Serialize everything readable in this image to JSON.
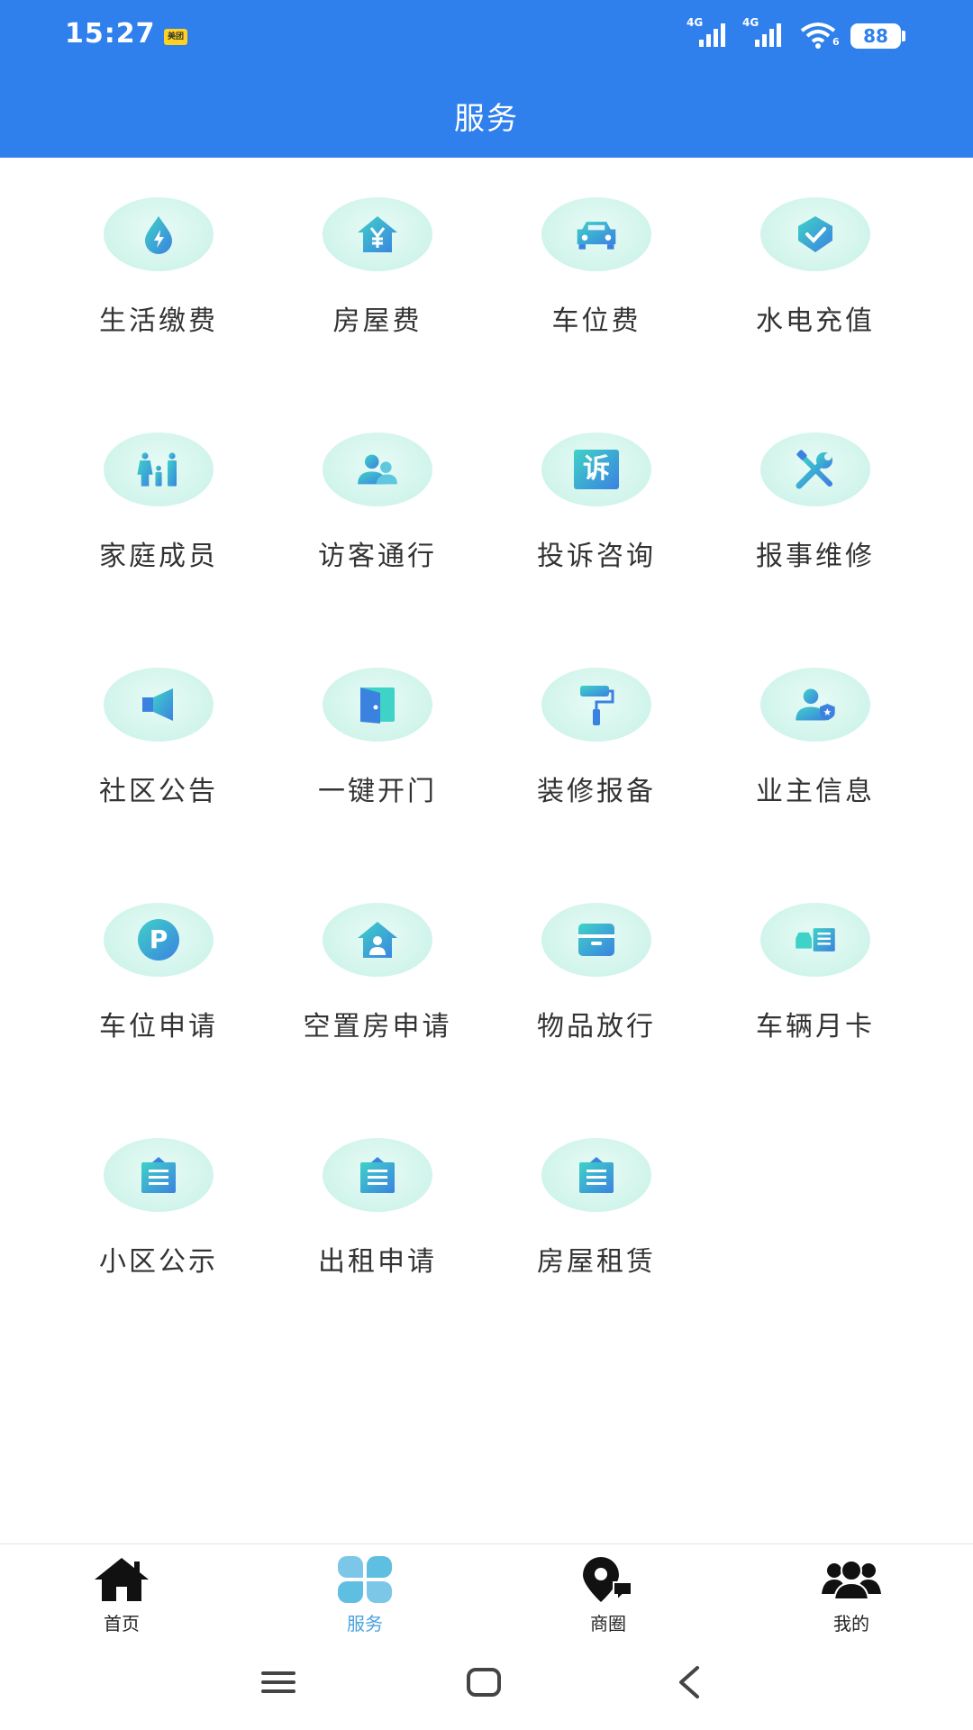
{
  "status_bar": {
    "time": "15:27",
    "notification_label": "美团",
    "signal_1": "4G",
    "signal_2": "4G",
    "wifi_sub": "6",
    "battery": "88"
  },
  "header": {
    "title": "服务"
  },
  "colors": {
    "primary": "#2f80ed",
    "bubble": "#c6f1e6",
    "icon_start": "#3fd2c7",
    "icon_end": "#3b82e0",
    "tab_active": "#4aa3df"
  },
  "services": [
    {
      "label": "生活缴费",
      "icon": "drop-bolt-icon"
    },
    {
      "label": "房屋费",
      "icon": "house-yuan-icon"
    },
    {
      "label": "车位费",
      "icon": "car-icon"
    },
    {
      "label": "水电充值",
      "icon": "check-shield-icon"
    },
    {
      "label": "家庭成员",
      "icon": "family-icon"
    },
    {
      "label": "访客通行",
      "icon": "visitors-icon"
    },
    {
      "label": "投诉咨询",
      "icon": "complaint-icon",
      "glyph": "诉"
    },
    {
      "label": "报事维修",
      "icon": "wrench-screwdriver-icon"
    },
    {
      "label": "社区公告",
      "icon": "megaphone-icon"
    },
    {
      "label": "一键开门",
      "icon": "door-icon"
    },
    {
      "label": "装修报备",
      "icon": "paint-roller-icon"
    },
    {
      "label": "业主信息",
      "icon": "owner-badge-icon"
    },
    {
      "label": "车位申请",
      "icon": "parking-icon",
      "glyph": "P"
    },
    {
      "label": "空置房申请",
      "icon": "house-person-icon"
    },
    {
      "label": "物品放行",
      "icon": "box-icon"
    },
    {
      "label": "车辆月卡",
      "icon": "car-card-icon"
    },
    {
      "label": "小区公示",
      "icon": "notice-board-icon"
    },
    {
      "label": "出租申请",
      "icon": "notice-board-icon"
    },
    {
      "label": "房屋租赁",
      "icon": "notice-board-icon"
    }
  ],
  "tabs": [
    {
      "label": "首页",
      "icon": "home-icon",
      "active": false
    },
    {
      "label": "服务",
      "icon": "clover-grid-icon",
      "active": true
    },
    {
      "label": "商圈",
      "icon": "location-chat-icon",
      "active": false
    },
    {
      "label": "我的",
      "icon": "people-icon",
      "active": false
    }
  ],
  "system_nav": [
    "menu-icon",
    "home-square-icon",
    "back-icon"
  ]
}
